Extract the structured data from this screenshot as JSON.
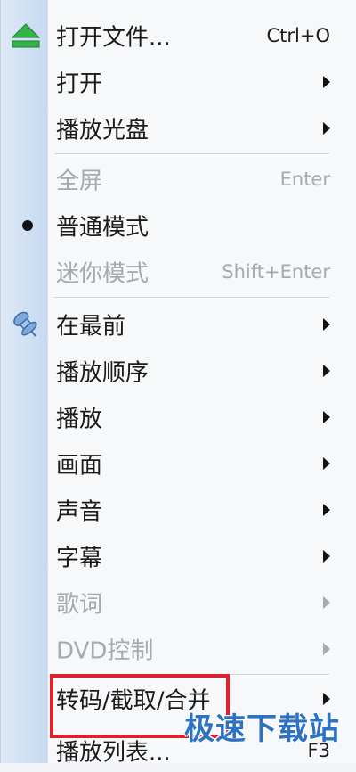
{
  "menu": {
    "items": [
      {
        "label": "打开文件...",
        "shortcut": "Ctrl+O",
        "icon": "eject-icon"
      },
      {
        "label": "打开"
      },
      {
        "label": "播放光盘"
      },
      {
        "label": "全屏",
        "shortcut": "Enter"
      },
      {
        "label": "普通模式",
        "icon": "bullet-icon"
      },
      {
        "label": "迷你模式",
        "shortcut": "Shift+Enter"
      },
      {
        "label": "在最前",
        "icon": "pin-icon"
      },
      {
        "label": "播放顺序"
      },
      {
        "label": "播放"
      },
      {
        "label": "画面"
      },
      {
        "label": "声音"
      },
      {
        "label": "字幕"
      },
      {
        "label": "歌词"
      },
      {
        "label": "DVD控制"
      },
      {
        "label": "转码/截取/合并"
      },
      {
        "label": "播放列表...",
        "shortcut": "F3"
      }
    ]
  },
  "watermark": "极速下载站",
  "colors": {
    "highlight": "#e0202a",
    "watermark": "#2d73c4",
    "disabled": "#a6a9ae"
  }
}
